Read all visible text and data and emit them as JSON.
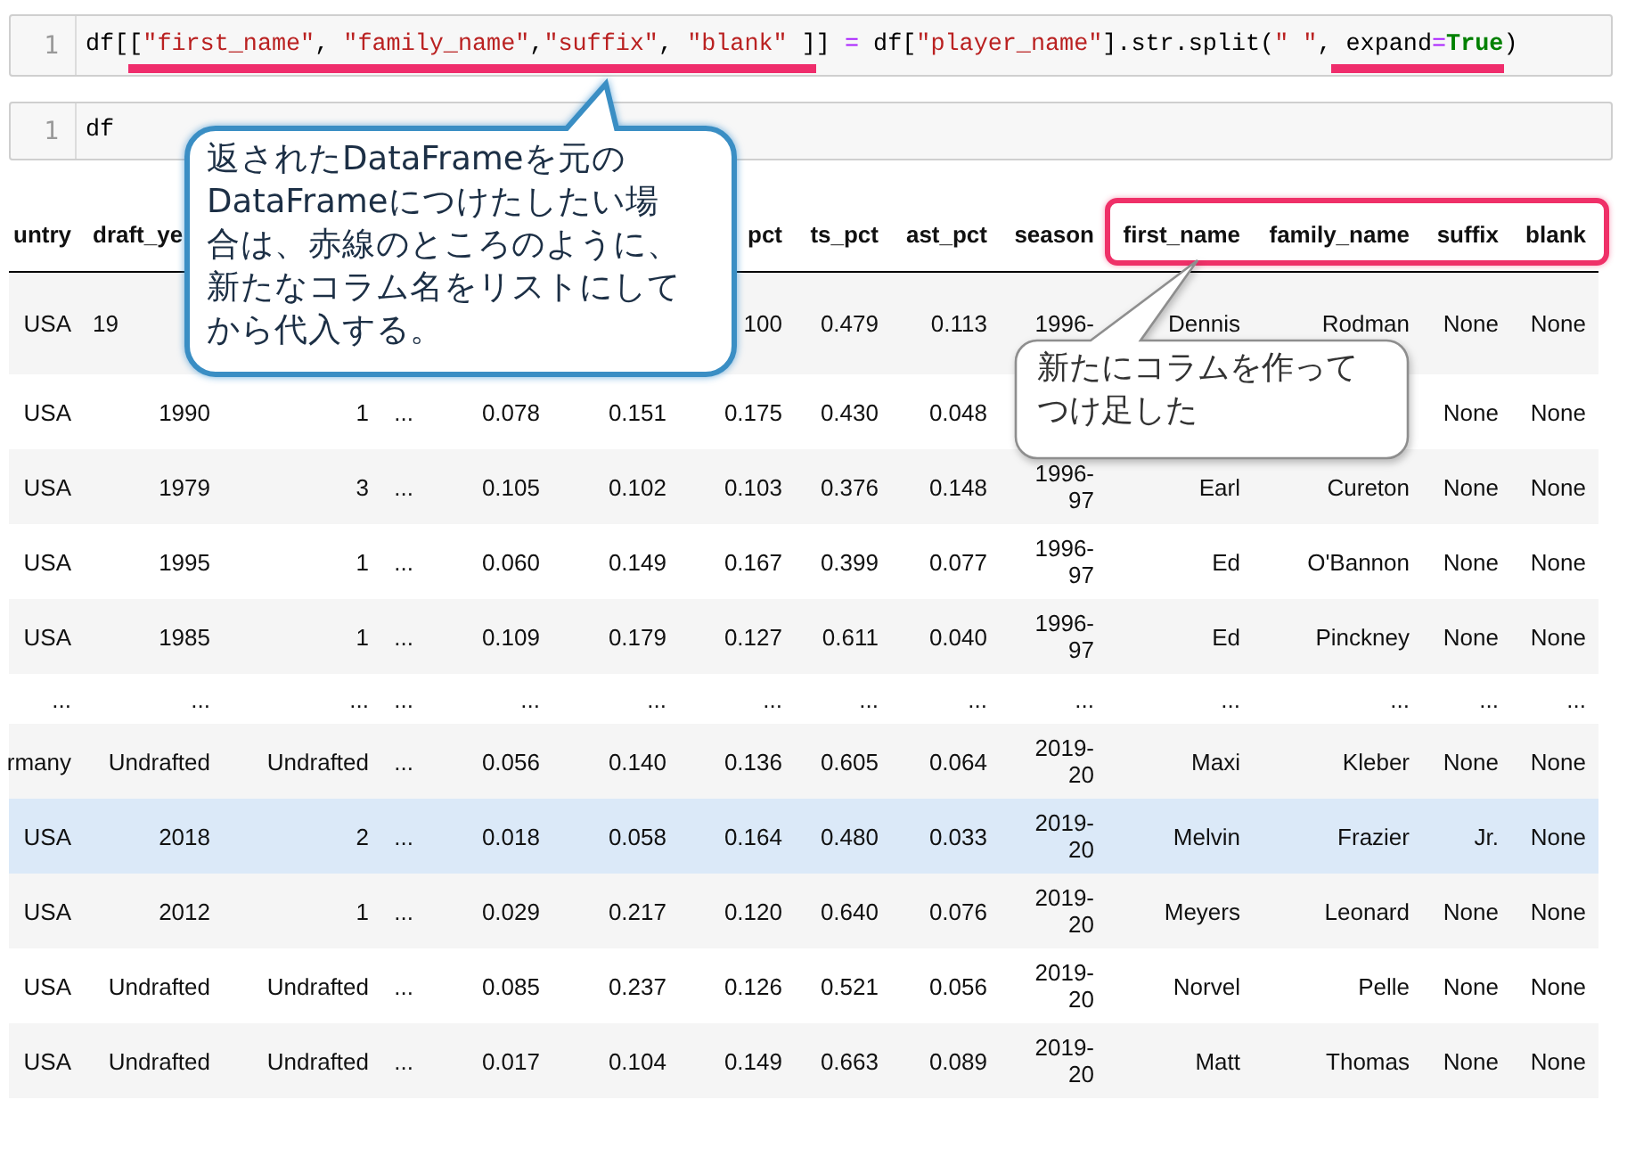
{
  "cells": [
    {
      "line_number": "1",
      "segments": [
        {
          "underlined": false,
          "tokens": [
            {
              "kind": "plain",
              "text": "df["
            }
          ]
        },
        {
          "underlined": true,
          "tokens": [
            {
              "kind": "plain",
              "text": "["
            },
            {
              "kind": "string",
              "text": "\"first_name\""
            },
            {
              "kind": "plain",
              "text": ", "
            },
            {
              "kind": "string",
              "text": "\"family_name\""
            },
            {
              "kind": "plain",
              "text": ","
            },
            {
              "kind": "string",
              "text": "\"suffix\""
            },
            {
              "kind": "plain",
              "text": ", "
            },
            {
              "kind": "string",
              "text": "\"blank\""
            },
            {
              "kind": "plain",
              "text": " ]"
            }
          ]
        },
        {
          "underlined": false,
          "tokens": [
            {
              "kind": "plain",
              "text": "] "
            },
            {
              "kind": "operator",
              "text": "="
            },
            {
              "kind": "plain",
              "text": " df["
            },
            {
              "kind": "string",
              "text": "\"player_name\""
            },
            {
              "kind": "plain",
              "text": "].str.split("
            },
            {
              "kind": "string",
              "text": "\" \""
            },
            {
              "kind": "plain",
              "text": ","
            }
          ]
        },
        {
          "underlined": true,
          "tokens": [
            {
              "kind": "plain",
              "text": " expand"
            },
            {
              "kind": "operator",
              "text": "="
            },
            {
              "kind": "keyword",
              "text": "True"
            }
          ]
        },
        {
          "underlined": false,
          "tokens": [
            {
              "kind": "plain",
              "text": ")"
            }
          ]
        }
      ]
    },
    {
      "line_number": "1",
      "segments": [
        {
          "underlined": false,
          "tokens": [
            {
              "kind": "plain",
              "text": "df"
            }
          ]
        }
      ]
    }
  ],
  "table": {
    "columns": [
      {
        "label": "untry",
        "boxed": false
      },
      {
        "label": "draft_ye",
        "boxed": false,
        "clipped_right": true
      },
      null,
      null,
      null,
      null,
      {
        "label": "pct",
        "boxed": false
      },
      {
        "label": "ts_pct",
        "boxed": false
      },
      {
        "label": "ast_pct",
        "boxed": false
      },
      {
        "label": "season",
        "boxed": false
      },
      {
        "label": "first_name",
        "boxed": true
      },
      {
        "label": "family_name",
        "boxed": true
      },
      {
        "label": "suffix",
        "boxed": true
      },
      {
        "label": "blank",
        "boxed": true
      }
    ],
    "rows": [
      {
        "kind": "data",
        "highlighted": false,
        "cells": [
          "USA",
          {
            "text": "19",
            "clipped_right": true
          },
          null,
          null,
          null,
          null,
          "100",
          "0.479",
          "0.113",
          "1996-",
          "Dennis",
          "Rodman",
          "None",
          "None"
        ]
      },
      {
        "kind": "data",
        "highlighted": false,
        "cells": [
          "USA",
          "1990",
          "1",
          "...",
          "0.078",
          "0.151",
          "0.175",
          "0.430",
          "0.048",
          null,
          null,
          null,
          "None",
          "None"
        ]
      },
      {
        "kind": "data",
        "highlighted": false,
        "cells": [
          "USA",
          "1979",
          "3",
          "...",
          "0.105",
          "0.102",
          "0.103",
          "0.376",
          "0.148",
          "1996-97",
          "Earl",
          "Cureton",
          "None",
          "None"
        ]
      },
      {
        "kind": "data",
        "highlighted": false,
        "cells": [
          "USA",
          "1995",
          "1",
          "...",
          "0.060",
          "0.149",
          "0.167",
          "0.399",
          "0.077",
          "1996-97",
          "Ed",
          "O'Bannon",
          "None",
          "None"
        ]
      },
      {
        "kind": "data",
        "highlighted": false,
        "cells": [
          "USA",
          "1985",
          "1",
          "...",
          "0.109",
          "0.179",
          "0.127",
          "0.611",
          "0.040",
          "1996-97",
          "Ed",
          "Pinckney",
          "None",
          "None"
        ]
      },
      {
        "kind": "ellipsis",
        "highlighted": false,
        "cells": [
          "...",
          "...",
          "...",
          "...",
          "...",
          "...",
          "...",
          "...",
          "...",
          "...",
          "...",
          "...",
          "...",
          "..."
        ]
      },
      {
        "kind": "data",
        "highlighted": false,
        "cells": [
          "rmany",
          "Undrafted",
          "Undrafted",
          "...",
          "0.056",
          "0.140",
          "0.136",
          "0.605",
          "0.064",
          "2019-20",
          "Maxi",
          "Kleber",
          "None",
          "None"
        ]
      },
      {
        "kind": "data",
        "highlighted": true,
        "cells": [
          "USA",
          "2018",
          "2",
          "...",
          "0.018",
          "0.058",
          "0.164",
          "0.480",
          "0.033",
          "2019-20",
          "Melvin",
          "Frazier",
          "Jr.",
          "None"
        ]
      },
      {
        "kind": "data",
        "highlighted": false,
        "cells": [
          "USA",
          "2012",
          "1",
          "...",
          "0.029",
          "0.217",
          "0.120",
          "0.640",
          "0.076",
          "2019-20",
          "Meyers",
          "Leonard",
          "None",
          "None"
        ]
      },
      {
        "kind": "data",
        "highlighted": false,
        "cells": [
          "USA",
          "Undrafted",
          "Undrafted",
          "...",
          "0.085",
          "0.237",
          "0.126",
          "0.521",
          "0.056",
          "2019-20",
          "Norvel",
          "Pelle",
          "None",
          "None"
        ]
      },
      {
        "kind": "data",
        "highlighted": false,
        "cells": [
          "USA",
          "Undrafted",
          "Undrafted",
          "...",
          "0.017",
          "0.104",
          "0.149",
          "0.663",
          "0.089",
          "2019-20",
          "Matt",
          "Thomas",
          "None",
          "None"
        ]
      }
    ]
  },
  "callouts": [
    {
      "kind": "accent",
      "text": "返されたDataFrameを元のDataFrameにつけたしたい場合は、赤線のところのように、新たなコラム名をリストにしてから代入する。"
    },
    {
      "kind": "plain",
      "text": "新たにコラムを作ってつけ足した"
    }
  ]
}
